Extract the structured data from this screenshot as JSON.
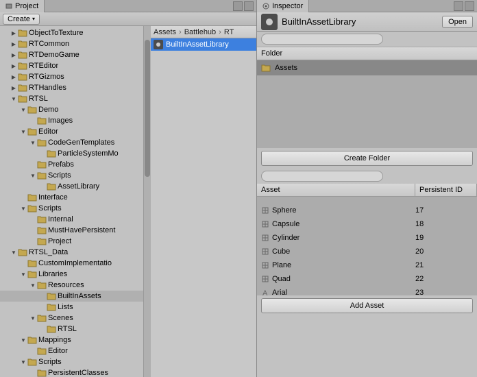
{
  "project": {
    "tab_label": "Project",
    "create_label": "Create",
    "breadcrumb": [
      "Assets",
      "Battlehub",
      "RT"
    ],
    "file_selected": "BuiltInAssetLibrary",
    "tree": [
      {
        "label": "ObjectToTexture",
        "depth": 1,
        "arrow": "collapsed"
      },
      {
        "label": "RTCommon",
        "depth": 1,
        "arrow": "collapsed"
      },
      {
        "label": "RTDemoGame",
        "depth": 1,
        "arrow": "collapsed"
      },
      {
        "label": "RTEditor",
        "depth": 1,
        "arrow": "collapsed"
      },
      {
        "label": "RTGizmos",
        "depth": 1,
        "arrow": "collapsed"
      },
      {
        "label": "RTHandles",
        "depth": 1,
        "arrow": "collapsed"
      },
      {
        "label": "RTSL",
        "depth": 1,
        "arrow": "expanded"
      },
      {
        "label": "Demo",
        "depth": 2,
        "arrow": "expanded"
      },
      {
        "label": "Images",
        "depth": 3,
        "arrow": ""
      },
      {
        "label": "Editor",
        "depth": 2,
        "arrow": "expanded"
      },
      {
        "label": "CodeGenTemplates",
        "depth": 3,
        "arrow": "expanded"
      },
      {
        "label": "ParticleSystemMo",
        "depth": 4,
        "arrow": ""
      },
      {
        "label": "Prefabs",
        "depth": 3,
        "arrow": ""
      },
      {
        "label": "Scripts",
        "depth": 3,
        "arrow": "expanded"
      },
      {
        "label": "AssetLibrary",
        "depth": 4,
        "arrow": ""
      },
      {
        "label": "Interface",
        "depth": 2,
        "arrow": ""
      },
      {
        "label": "Scripts",
        "depth": 2,
        "arrow": "expanded"
      },
      {
        "label": "Internal",
        "depth": 3,
        "arrow": ""
      },
      {
        "label": "MustHavePersistent",
        "depth": 3,
        "arrow": ""
      },
      {
        "label": "Project",
        "depth": 3,
        "arrow": ""
      },
      {
        "label": "RTSL_Data",
        "depth": 1,
        "arrow": "expanded"
      },
      {
        "label": "CustomImplementatio",
        "depth": 2,
        "arrow": ""
      },
      {
        "label": "Libraries",
        "depth": 2,
        "arrow": "expanded"
      },
      {
        "label": "Resources",
        "depth": 3,
        "arrow": "expanded"
      },
      {
        "label": "BuiltInAssets",
        "depth": 4,
        "arrow": "",
        "selected": true
      },
      {
        "label": "Lists",
        "depth": 4,
        "arrow": ""
      },
      {
        "label": "Scenes",
        "depth": 3,
        "arrow": "expanded"
      },
      {
        "label": "RTSL",
        "depth": 4,
        "arrow": ""
      },
      {
        "label": "Mappings",
        "depth": 2,
        "arrow": "expanded"
      },
      {
        "label": "Editor",
        "depth": 3,
        "arrow": ""
      },
      {
        "label": "Scripts",
        "depth": 2,
        "arrow": "expanded"
      },
      {
        "label": "PersistentClasses",
        "depth": 3,
        "arrow": ""
      }
    ]
  },
  "inspector": {
    "tab_label": "Inspector",
    "title": "BuiltInAssetLibrary",
    "open_label": "Open",
    "folder_header": "Folder",
    "folder_item": "Assets",
    "create_folder_label": "Create Folder",
    "asset_header": "Asset",
    "id_header": "Persistent ID",
    "add_asset_label": "Add Asset",
    "assets": [
      {
        "name": "Sphere",
        "id": "17",
        "icon": "mesh"
      },
      {
        "name": "Capsule",
        "id": "18",
        "icon": "mesh"
      },
      {
        "name": "Cylinder",
        "id": "19",
        "icon": "mesh"
      },
      {
        "name": "Cube",
        "id": "20",
        "icon": "mesh"
      },
      {
        "name": "Plane",
        "id": "21",
        "icon": "mesh"
      },
      {
        "name": "Quad",
        "id": "22",
        "icon": "mesh"
      },
      {
        "name": "Arial",
        "id": "23",
        "icon": "font"
      }
    ]
  }
}
